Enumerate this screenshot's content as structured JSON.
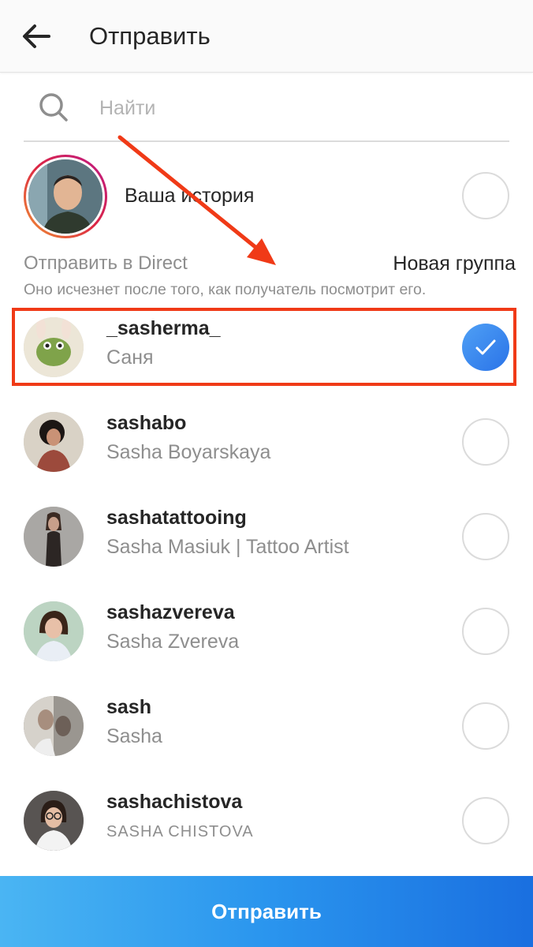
{
  "header": {
    "title": "Отправить"
  },
  "search": {
    "placeholder": "Найти"
  },
  "story": {
    "label": "Ваша история"
  },
  "direct": {
    "label": "Отправить в Direct",
    "new_group": "Новая группа",
    "note": "Оно исчезнет после того, как получатель посмотрит его."
  },
  "users": [
    {
      "username": "_sasherma_",
      "fullname": "Саня",
      "selected": true
    },
    {
      "username": "sashabo",
      "fullname": "Sasha Boyarskaya",
      "selected": false
    },
    {
      "username": "sashatattooing",
      "fullname": "Sasha Masiuk | Tattoo Artist",
      "selected": false
    },
    {
      "username": "sashazvereva",
      "fullname": "Sasha Zvereva",
      "selected": false
    },
    {
      "username": "sash",
      "fullname": "Sasha",
      "selected": false
    },
    {
      "username": "sashachistova",
      "fullname": "SASHA CHISTOVA",
      "selected": false
    }
  ],
  "send_button": {
    "label": "Отправить"
  },
  "colors": {
    "accent": "#3897f0",
    "annotation": "#f03a17",
    "send_gradient_start": "#4ab5f3",
    "send_gradient_end": "#1a6fe0"
  },
  "icons": {
    "back": "arrow-left-icon",
    "search": "magnifier-icon",
    "check": "checkmark-icon"
  }
}
